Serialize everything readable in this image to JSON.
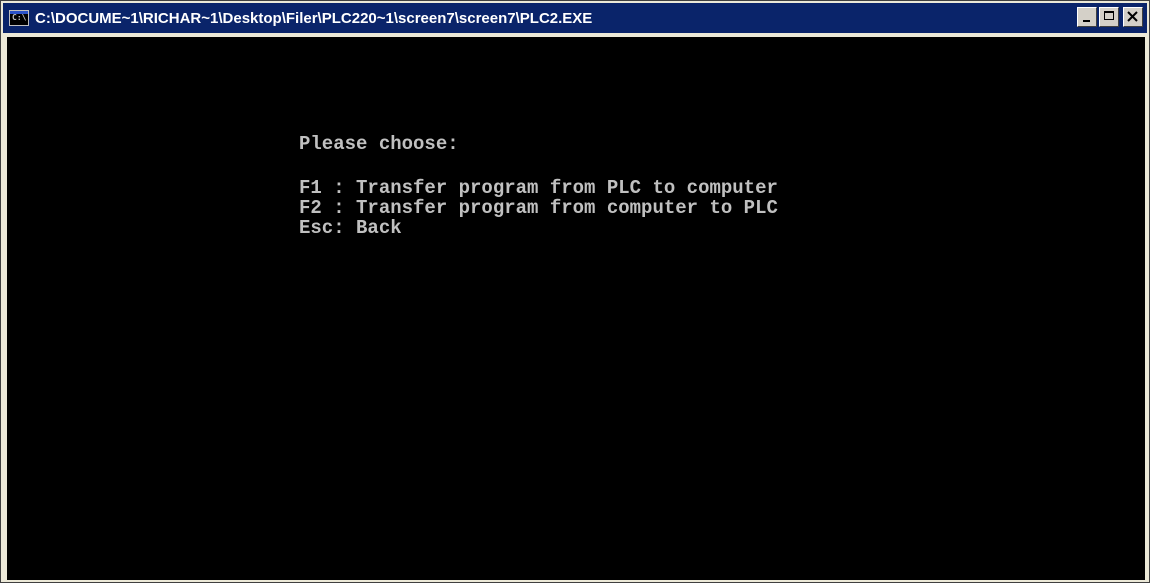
{
  "window": {
    "title": "C:\\DOCUME~1\\RICHAR~1\\Desktop\\Filer\\PLC220~1\\screen7\\screen7\\PLC2.EXE",
    "icon": "console-icon",
    "icon_text": "C:\\"
  },
  "console": {
    "prompt": "Please choose:",
    "options": [
      "F1 : Transfer program from PLC to computer",
      "F2 : Transfer program from computer to PLC",
      "Esc: Back"
    ]
  },
  "colors": {
    "title_bar": "#0a246a",
    "console_bg": "#000000",
    "console_text": "#c0c0c0"
  }
}
